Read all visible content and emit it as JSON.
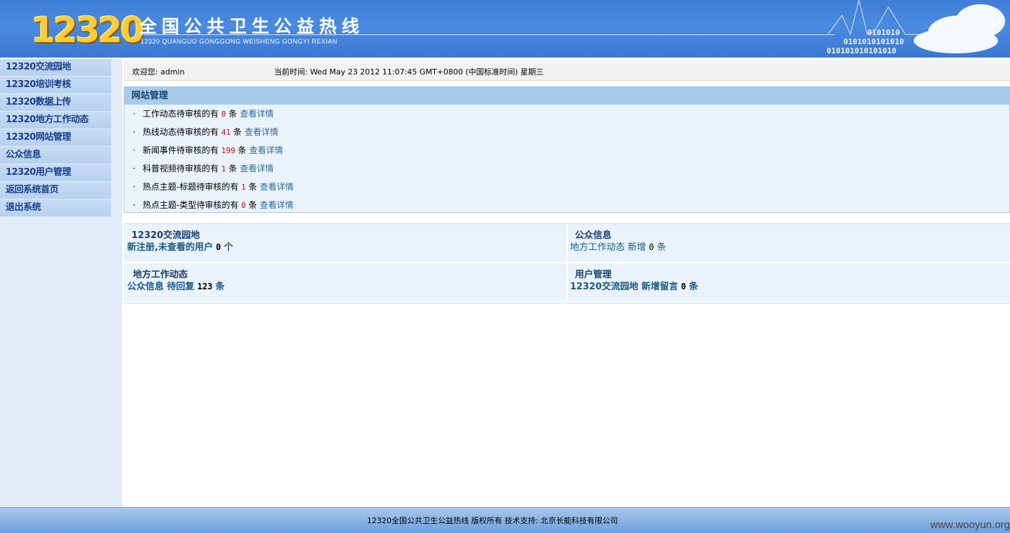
{
  "header": {
    "logo_text": "12320",
    "title": "全国公共卫生公益热线",
    "subtitle": "12320  QUANGUO GONGGONG WEISHENG GONGYI REXIAN"
  },
  "sidebar": {
    "items": [
      {
        "label": "12320交流园地"
      },
      {
        "label": "12320培训考核"
      },
      {
        "label": "12320数据上传"
      },
      {
        "label": "12320地方工作动态"
      },
      {
        "label": "12320网站管理"
      },
      {
        "label": "公众信息"
      },
      {
        "label": "12320用户管理"
      },
      {
        "label": "返回系统首页"
      },
      {
        "label": "退出系统"
      }
    ]
  },
  "welcome": {
    "greeting": "欢迎您: admin",
    "time": "当前时间: Wed May 23 2012 11:07:45 GMT+0800 (中国标准时间) 星期三"
  },
  "panel": {
    "title": "网站管理",
    "rows": [
      {
        "text": "工作动态待审核的有",
        "count": "0",
        "unit": "条",
        "link": "查看详情"
      },
      {
        "text": "热线动态待审核的有",
        "count": "41",
        "unit": "条",
        "link": "查看详情"
      },
      {
        "text": "新闻事件待审核的有",
        "count": "199",
        "unit": "条",
        "link": "查看详情"
      },
      {
        "text": "科普视频待审核的有",
        "count": "1",
        "unit": "条",
        "link": "查看详情"
      },
      {
        "text": "热点主题-标题待审核的有",
        "count": "1",
        "unit": "条",
        "link": "查看详情"
      },
      {
        "text": "热点主题-类型待审核的有",
        "count": "0",
        "unit": "条",
        "link": "查看详情"
      }
    ]
  },
  "grid": {
    "exchange": {
      "title": "12320交流园地",
      "line": "新注册,未查看的用户",
      "count": "0",
      "unit": "个"
    },
    "public_info": {
      "title": "公众信息",
      "line": "地方工作动态 新增",
      "count": "0",
      "unit": "条"
    },
    "local_work": {
      "title": "地方工作动态",
      "line": "公众信息 待回复",
      "count": "123",
      "unit": "条"
    },
    "user_mgmt": {
      "title": "用户管理",
      "line": "12320交流园地 新增留言",
      "count": "0",
      "unit": "条"
    }
  },
  "footer": {
    "text": "12320全国公共卫生公益热线 版权所有 技术支持: 北京长能科技有限公司"
  },
  "watermark": "www.wooyun.org"
}
